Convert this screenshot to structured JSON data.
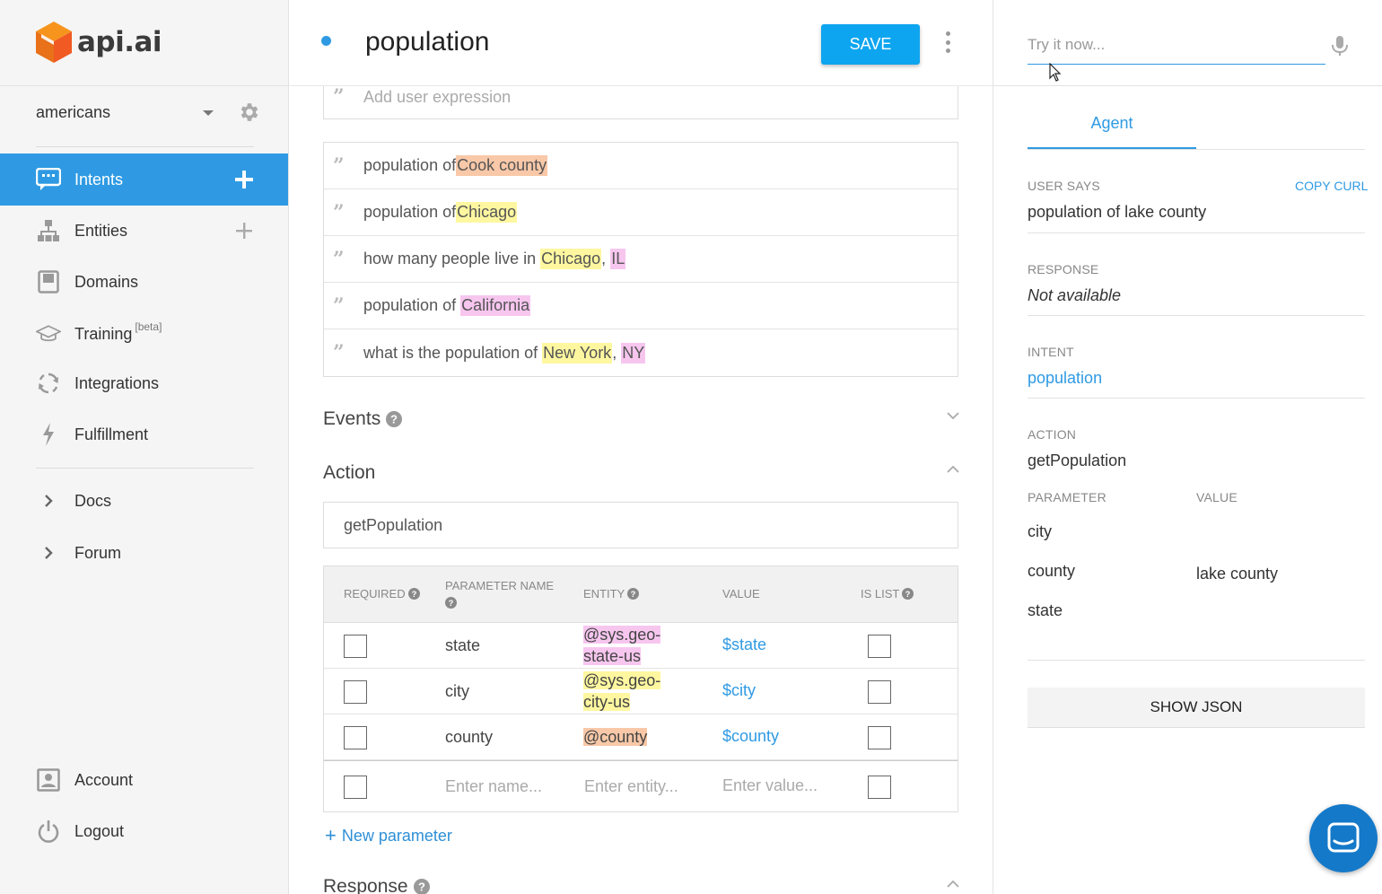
{
  "brand": {
    "name": "api.ai",
    "accent": "#2f9ae3",
    "save_color": "#0ea5f0"
  },
  "sidebar": {
    "agent": "americans",
    "items": [
      {
        "label": "Intents",
        "icon": "chat-icon",
        "active": true,
        "has_add": true
      },
      {
        "label": "Entities",
        "icon": "hierarchy-icon",
        "has_add": true
      },
      {
        "label": "Domains",
        "icon": "book-icon"
      },
      {
        "label": "Training",
        "icon": "graduation-cap-icon",
        "sup": "[beta]"
      },
      {
        "label": "Integrations",
        "icon": "sync-icon"
      },
      {
        "label": "Fulfillment",
        "icon": "lightning-icon"
      },
      {
        "label": "Docs",
        "icon": "chevron-right-icon"
      },
      {
        "label": "Forum",
        "icon": "chevron-right-icon"
      },
      {
        "label": "Account",
        "icon": "account-icon"
      },
      {
        "label": "Logout",
        "icon": "power-icon"
      }
    ]
  },
  "main": {
    "title": "population",
    "save_label": "SAVE",
    "add_expression_placeholder": "Add user expression",
    "expressions": [
      [
        "population of ",
        "Cook county"
      ],
      [
        "population of ",
        "Chicago"
      ],
      [
        "how many people live in ",
        "Chicago",
        ", ",
        "IL"
      ],
      [
        "population of ",
        "California"
      ],
      [
        "what is the population of ",
        "New York",
        ", ",
        "NY"
      ]
    ],
    "events_title": "Events",
    "action_title": "Action",
    "action_value": "getPopulation",
    "table": {
      "headers": {
        "required": "REQUIRED",
        "name": "PARAMETER NAME",
        "entity": "ENTITY",
        "value": "VALUE",
        "is_list": "IS LIST"
      },
      "rows": [
        {
          "name": "state",
          "entity_1": "@sys.geo-",
          "entity_2": "state-us",
          "value": "$state"
        },
        {
          "name": "city",
          "entity_1": "@sys.geo-",
          "entity_2": "city-us",
          "value": "$city"
        },
        {
          "name": "county",
          "entity_1": "@county",
          "entity_2": "",
          "value": "$county"
        }
      ],
      "placeholders": {
        "name": "Enter name...",
        "entity": "Enter entity...",
        "value": "Enter value..."
      }
    },
    "new_parameter": "New parameter",
    "response_title": "Response"
  },
  "right": {
    "try_placeholder": "Try it now...",
    "tab": "Agent",
    "user_says_label": "USER SAYS",
    "copy_curl": "COPY CURL",
    "user_says": "population of lake county",
    "response_label": "RESPONSE",
    "response": "Not available",
    "intent_label": "INTENT",
    "intent": "population",
    "action_label": "ACTION",
    "action": "getPopulation",
    "parameter_label": "PARAMETER",
    "value_label": "VALUE",
    "params": [
      {
        "name": "city",
        "value": ""
      },
      {
        "name": "county",
        "value": "lake county"
      },
      {
        "name": "state",
        "value": ""
      }
    ],
    "show_json": "SHOW JSON"
  }
}
